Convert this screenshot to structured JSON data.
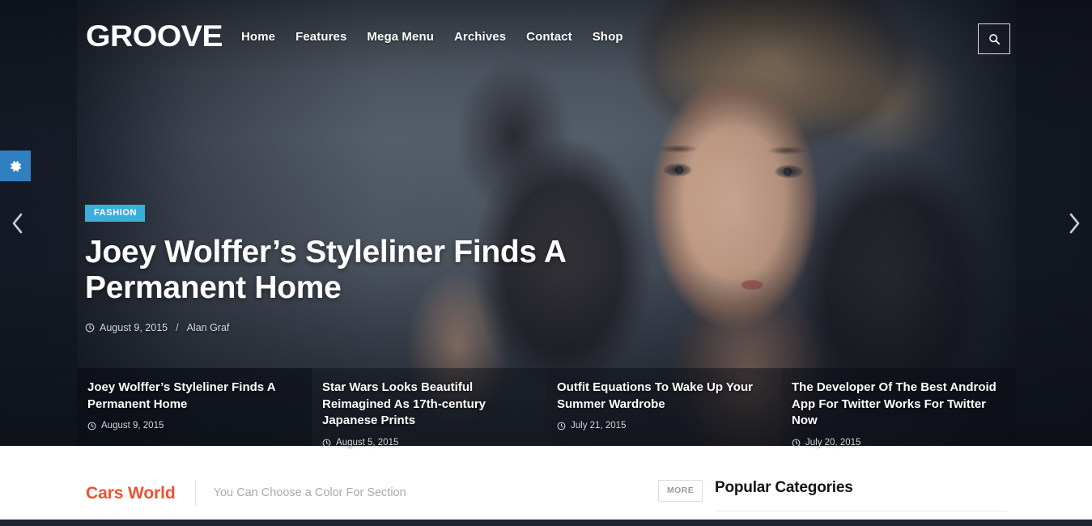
{
  "site": {
    "logo": "GROOVE",
    "accent_blue": "#2f7fc1",
    "badge_blue": "#3aafdd",
    "accent_red": "#f0512f"
  },
  "header": {
    "nav": [
      {
        "label": "Home"
      },
      {
        "label": "Features"
      },
      {
        "label": "Mega Menu"
      },
      {
        "label": "Archives"
      },
      {
        "label": "Contact"
      },
      {
        "label": "Shop"
      }
    ],
    "search_icon": "search-icon"
  },
  "sidebar": {
    "settings_icon": "gear-icon"
  },
  "slider": {
    "prev_icon": "chevron-left-icon",
    "next_icon": "chevron-right-icon",
    "featured": {
      "category": "FASHION",
      "title": "Joey Wolffer’s Styleliner Finds A Permanent Home",
      "date": "August 9, 2015",
      "separator": "/",
      "author": "Alan Graf",
      "clock_icon": "clock-icon"
    },
    "thumbnails": [
      {
        "title": "Joey Wolffer’s Styleliner Finds A Permanent Home",
        "date": "August 9, 2015"
      },
      {
        "title": "Star Wars Looks Beautiful Reimagined As 17th-century Japanese Prints",
        "date": "August 5, 2015"
      },
      {
        "title": "Outfit Equations To Wake Up Your Summer Wardrobe",
        "date": "July 21, 2015"
      },
      {
        "title": "The Developer Of The Best Android App For Twitter Works For Twitter Now",
        "date": "July 20, 2015"
      }
    ]
  },
  "section": {
    "title": "Cars World",
    "subtitle": "You Can Choose a Color For Section",
    "more_label": "MORE"
  },
  "sidebar_widget": {
    "title": "Popular Categories"
  }
}
